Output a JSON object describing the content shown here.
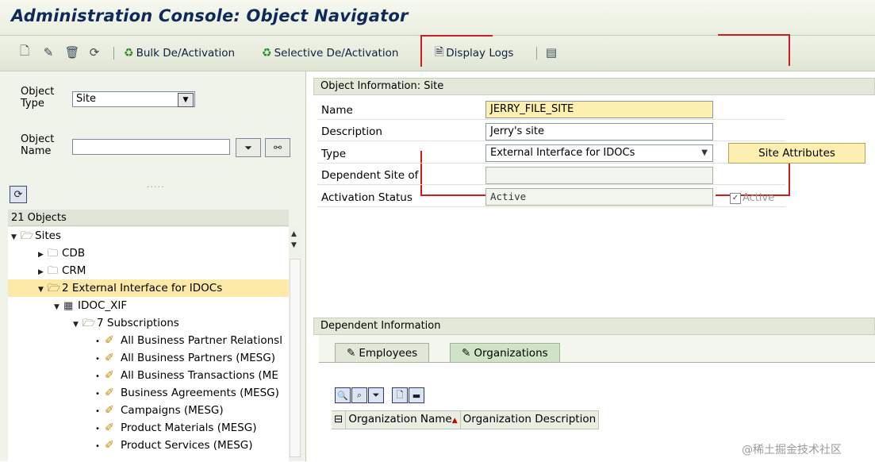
{
  "window": {
    "title": "Administration Console: Object Navigator"
  },
  "toolbar": {
    "bulk_label": "Bulk De/Activation",
    "selective_label": "Selective De/Activation",
    "logs_label": "Display Logs"
  },
  "left": {
    "object_type_label_1": "Object",
    "object_type_label_2": "Type",
    "object_type_value": "Site",
    "object_name_label_1": "Object",
    "object_name_label_2": "Name",
    "object_name_value": "",
    "count_header": "21 Objects",
    "tree": [
      {
        "label": "Sites"
      },
      {
        "label": "CDB"
      },
      {
        "label": "CRM"
      },
      {
        "label": "2 External Interface for IDOCs"
      },
      {
        "label": "IDOC_XIF"
      },
      {
        "label": "7 Subscriptions"
      },
      {
        "label": "All Business Partner Relationsl"
      },
      {
        "label": "All Business Partners (MESG)"
      },
      {
        "label": "All Business Transactions (ME"
      },
      {
        "label": "Business Agreements (MESG)"
      },
      {
        "label": "Campaigns (MESG)"
      },
      {
        "label": "Product Materials (MESG)"
      },
      {
        "label": "Product Services (MESG)"
      }
    ]
  },
  "object_info": {
    "header": "Object Information: Site",
    "name_label": "Name",
    "name_value": "JERRY_FILE_SITE",
    "description_label": "Description",
    "description_value": "Jerry's site",
    "type_label": "Type",
    "type_value": "External Interface for IDOCs",
    "dependent_label": "Dependent Site of",
    "dependent_value": "",
    "activation_label": "Activation Status",
    "activation_value": "Active",
    "site_attributes_button": "Site Attributes",
    "active_checkbox_label": "Active"
  },
  "dependent": {
    "header": "Dependent Information",
    "tab_employees": "Employees",
    "tab_organizations": "Organizations",
    "col_org_name": "Organization Name",
    "col_org_desc": "Organization Description"
  },
  "watermark": "@稀土掘金技术社区",
  "colors": {
    "highlight": "#fce9a8",
    "annotation_red": "#d01c1c",
    "title": "#0f2a5a"
  }
}
